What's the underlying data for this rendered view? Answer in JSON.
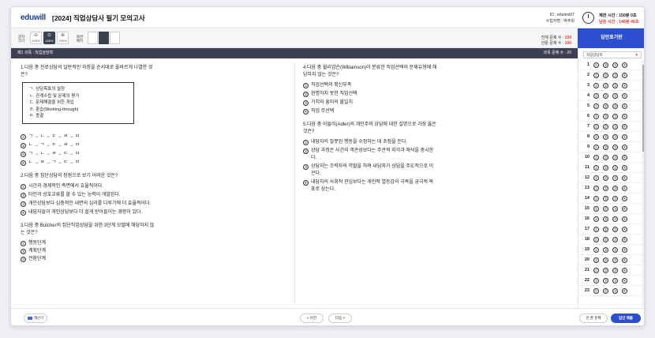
{
  "header": {
    "logo": "eduwill",
    "title": "[2024] 직업상담사 필기 모의고사",
    "user_id": "ID : edutest07",
    "user_name": "수험자명 : 박주희",
    "time_limit": "제한 시간 : 150분 0초",
    "time_left": "남은 시간 : 146분 46초"
  },
  "toolbar": {
    "font_size_label": "글자\n크기",
    "zoom": [
      {
        "icon": "zoom-out-icon",
        "label": "100%"
      },
      {
        "icon": "zoom-icon",
        "label": "150%"
      },
      {
        "icon": "zoom-in-icon",
        "label": "200%"
      }
    ],
    "screen_layout_label": "화면\n배치",
    "total_problems": "전체 문제 수 : ",
    "total_value": "100",
    "unanswered": "안푼 문제 수 : ",
    "unanswered_value": "100",
    "submit_answers": "답안표기란"
  },
  "subject": {
    "title": "제1 과목 : 직업상담학",
    "count": "과목 문제 수 : 20"
  },
  "questions_left": [
    {
      "title": "1.다음 중 진로상담의 일반적인 과정을 순서대로 올바르게 나열한 것은?",
      "box": [
        "ㄱ. 상담목표의 설정",
        "ㄴ. 관계수립 및 문제의 평가",
        "ㄷ. 문제해결을 위한 개입",
        "ㄹ. 훈습(Working-through)",
        "ㅁ. 종결"
      ],
      "options": [
        "ㄱ → ㄴ → ㄷ → ㄹ → ㅁ",
        "ㄴ → ㄱ → ㄷ → ㄹ → ㅁ",
        "ㄱ → ㄴ → ㄹ → ㄷ → ㅁ",
        "ㄴ → ㄹ → ㄱ → ㄷ → ㅁ"
      ]
    },
    {
      "title": "2.다음 중 집단상담의 장점으로 보기 어려운 것은?",
      "options": [
        "시간과 경제적인 측면에서 효율적이다.",
        "타인과 상호교류를 할 수 있는 능력이 개발된다.",
        "개인상담보다 심층적인 내면의 심리를 다루기에 더 효율적이다.",
        "내담자들이 개인상담보다 더 쉽게 받아들이는 경향이 있다."
      ]
    },
    {
      "title": "3.다음 중 Butcher의 집단직업상담을 위한 3단계 모델에 해당하지 않는 것은?",
      "options": [
        "행동단계",
        "계획단계",
        "전환단계"
      ]
    }
  ],
  "questions_right": [
    {
      "title": "4.다음 중 윌리암슨(Williamson)이 분류한 직업선택의 문제유형에 해당하지 않는 것은?",
      "options": [
        "직업선택의 확신부족",
        "현명하지 못한 직업선택",
        "가치와 흥미의 불일치",
        "직업 무선택"
      ]
    },
    {
      "title": "5.다음 중 아들러(Adler)의 개인주의 상담에 대한 설명으로 가장 옳은 것은?",
      "options": [
        "내담자의 잘못된 행동을 수정하는 데 초점을 둔다.",
        "상담 과정은 사건의 객관성보다는 주관적 지각과 해석을 중시한다.",
        "상담자는 조력자의 역할을 하며 내담자가 상담을 주도적으로 이끈다.",
        "내담자의 사회적 관심보다는 개인적 열등감의 극복을 궁극적 목표로 삼는다."
      ]
    }
  ],
  "option_marks": [
    "①",
    "②",
    "③",
    "④"
  ],
  "panel": {
    "subject_select": "직업상담학",
    "rows": [
      "1",
      "2",
      "3",
      "4",
      "5",
      "6",
      "7",
      "8",
      "9",
      "10",
      "11",
      "12",
      "13",
      "14",
      "15",
      "16",
      "17",
      "18",
      "19",
      "20",
      "21",
      "22",
      "23"
    ],
    "bubbles": [
      "①",
      "②",
      "③",
      "④"
    ]
  },
  "footer": {
    "calculator": "계산기",
    "prev": "< 이전",
    "next": "다음 >",
    "unanswered": "안 푼 문제",
    "submit": "답안 제출"
  }
}
